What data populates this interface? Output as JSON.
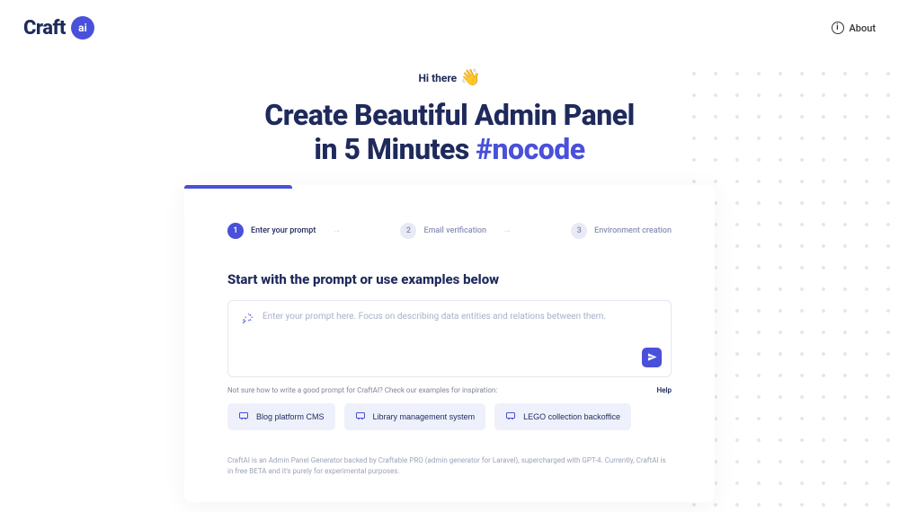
{
  "header": {
    "logo_text": "Craft",
    "logo_badge": "ai",
    "about_label": "About"
  },
  "hero": {
    "greeting": "Hi there",
    "title_line1": "Create Beautiful Admin Panel",
    "title_line2_prefix": "in 5 Minutes ",
    "title_hashtag": "#nocode"
  },
  "stepper": {
    "steps": [
      {
        "num": "1",
        "label": "Enter your prompt",
        "active": true,
        "arrow": true
      },
      {
        "num": "2",
        "label": "Email verification",
        "active": false,
        "arrow": true
      },
      {
        "num": "3",
        "label": "Environment creation",
        "active": false,
        "arrow": false
      }
    ]
  },
  "prompt": {
    "section_title": "Start with the prompt or use examples below",
    "placeholder": "Enter your prompt here. Focus on describing data entities and relations between them.",
    "help_text": "Not sure how to write a good prompt for CraftAI? Check our examples for inspiration:",
    "help_link": "Help"
  },
  "examples": [
    "Blog platform CMS",
    "Library management system",
    "LEGO collection backoffice"
  ],
  "disclaimer": "CraftAI is an Admin Panel Generator backed by Craftable PRO (admin generator for Laravel), supercharged with GPT-4. Currently, CraftAI is in free BETA and it's purely for experimental purposes."
}
